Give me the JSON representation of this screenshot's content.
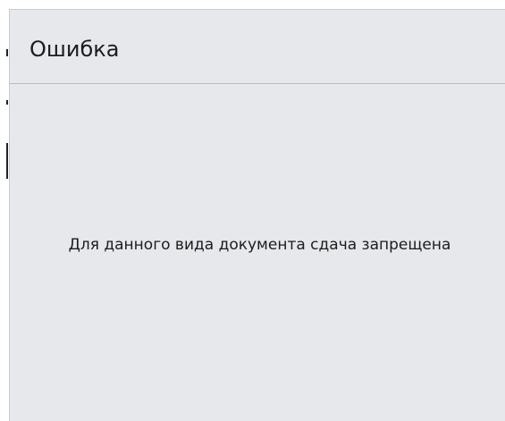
{
  "dialog": {
    "title": "Ошибка",
    "message": "Для данного вида документа сдача запрещена",
    "background_color": "#e6e8eb",
    "divider_color": "#b9bec4",
    "text_color": "#1c1c1c"
  }
}
